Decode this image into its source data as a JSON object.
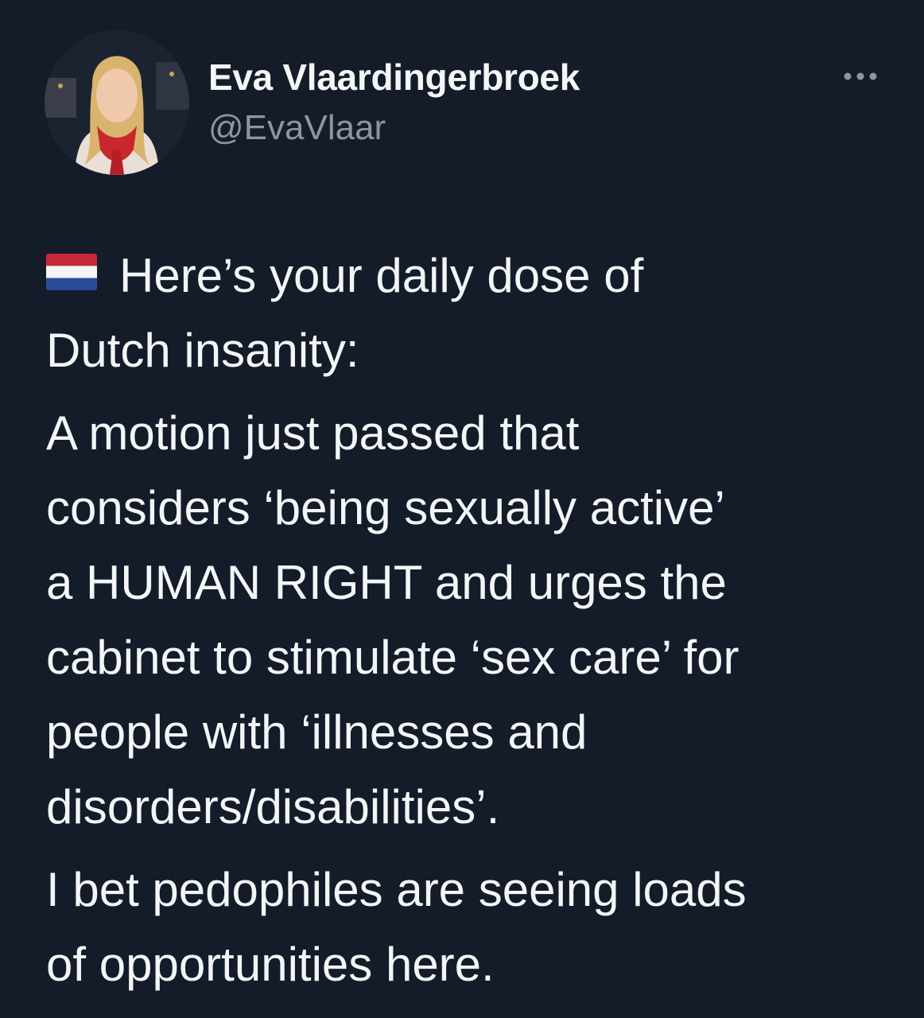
{
  "author": {
    "name": "Eva Vlaardingerbroek",
    "handle": "@EvaVlaar",
    "avatar_icon": "profile-photo"
  },
  "menu": {
    "icon": "more-horizontal-icon"
  },
  "tweet": {
    "flag_icon": "netherlands-flag",
    "paragraphs": [
      [
        "Here’s your daily dose of",
        "Dutch insanity:"
      ],
      [
        "A motion just passed that",
        "considers ‘being sexually active’",
        "a HUMAN RIGHT and urges the",
        "cabinet to stimulate ‘sex care’ for",
        "people with ‘illnesses and",
        "disorders/disabilities’."
      ],
      [
        "I bet pedophiles are seeing loads",
        "of opportunities here."
      ]
    ]
  },
  "colors": {
    "background": "#141c29",
    "text": "#f3f5f7",
    "secondary_text": "#8a96a3"
  }
}
